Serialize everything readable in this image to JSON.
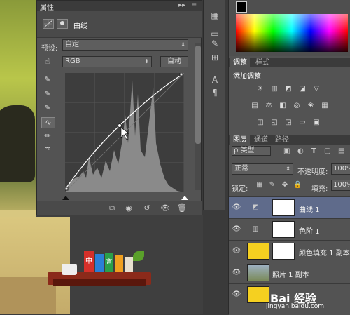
{
  "props": {
    "title": "属性",
    "menu_icon": "≡",
    "collapse_icon": "▸▸",
    "adj_name": "曲线",
    "preset_label": "预设:",
    "preset_value": "自定",
    "channel_value": "RGB",
    "auto_label": "自动"
  },
  "right": {
    "tabs_adjust": [
      "调整",
      "样式"
    ],
    "add_adjust": "添加调整",
    "tabs_layers": [
      "图层",
      "通道",
      "路径"
    ],
    "filter_label": "ρ 类型",
    "blend_mode": "正常",
    "opacity_label": "不透明度:",
    "opacity_value": "100%",
    "lock_label": "锁定:",
    "fill_label": "填充:",
    "fill_value": "100%"
  },
  "layers": [
    {
      "name": "曲线 1"
    },
    {
      "name": "色阶 1"
    },
    {
      "name": "颜色填充 1 副本"
    },
    {
      "name": "照片 1 副本"
    },
    {
      "name": ""
    }
  ],
  "watermark": {
    "text": "Bai 经验",
    "url": "jingyan.baidu.com"
  },
  "logo": {
    "letters": [
      "中",
      "言"
    ]
  },
  "colors": {
    "accent_selected": "#5f6b8b",
    "panel": "#535353",
    "dark": "#3b3b3b"
  }
}
